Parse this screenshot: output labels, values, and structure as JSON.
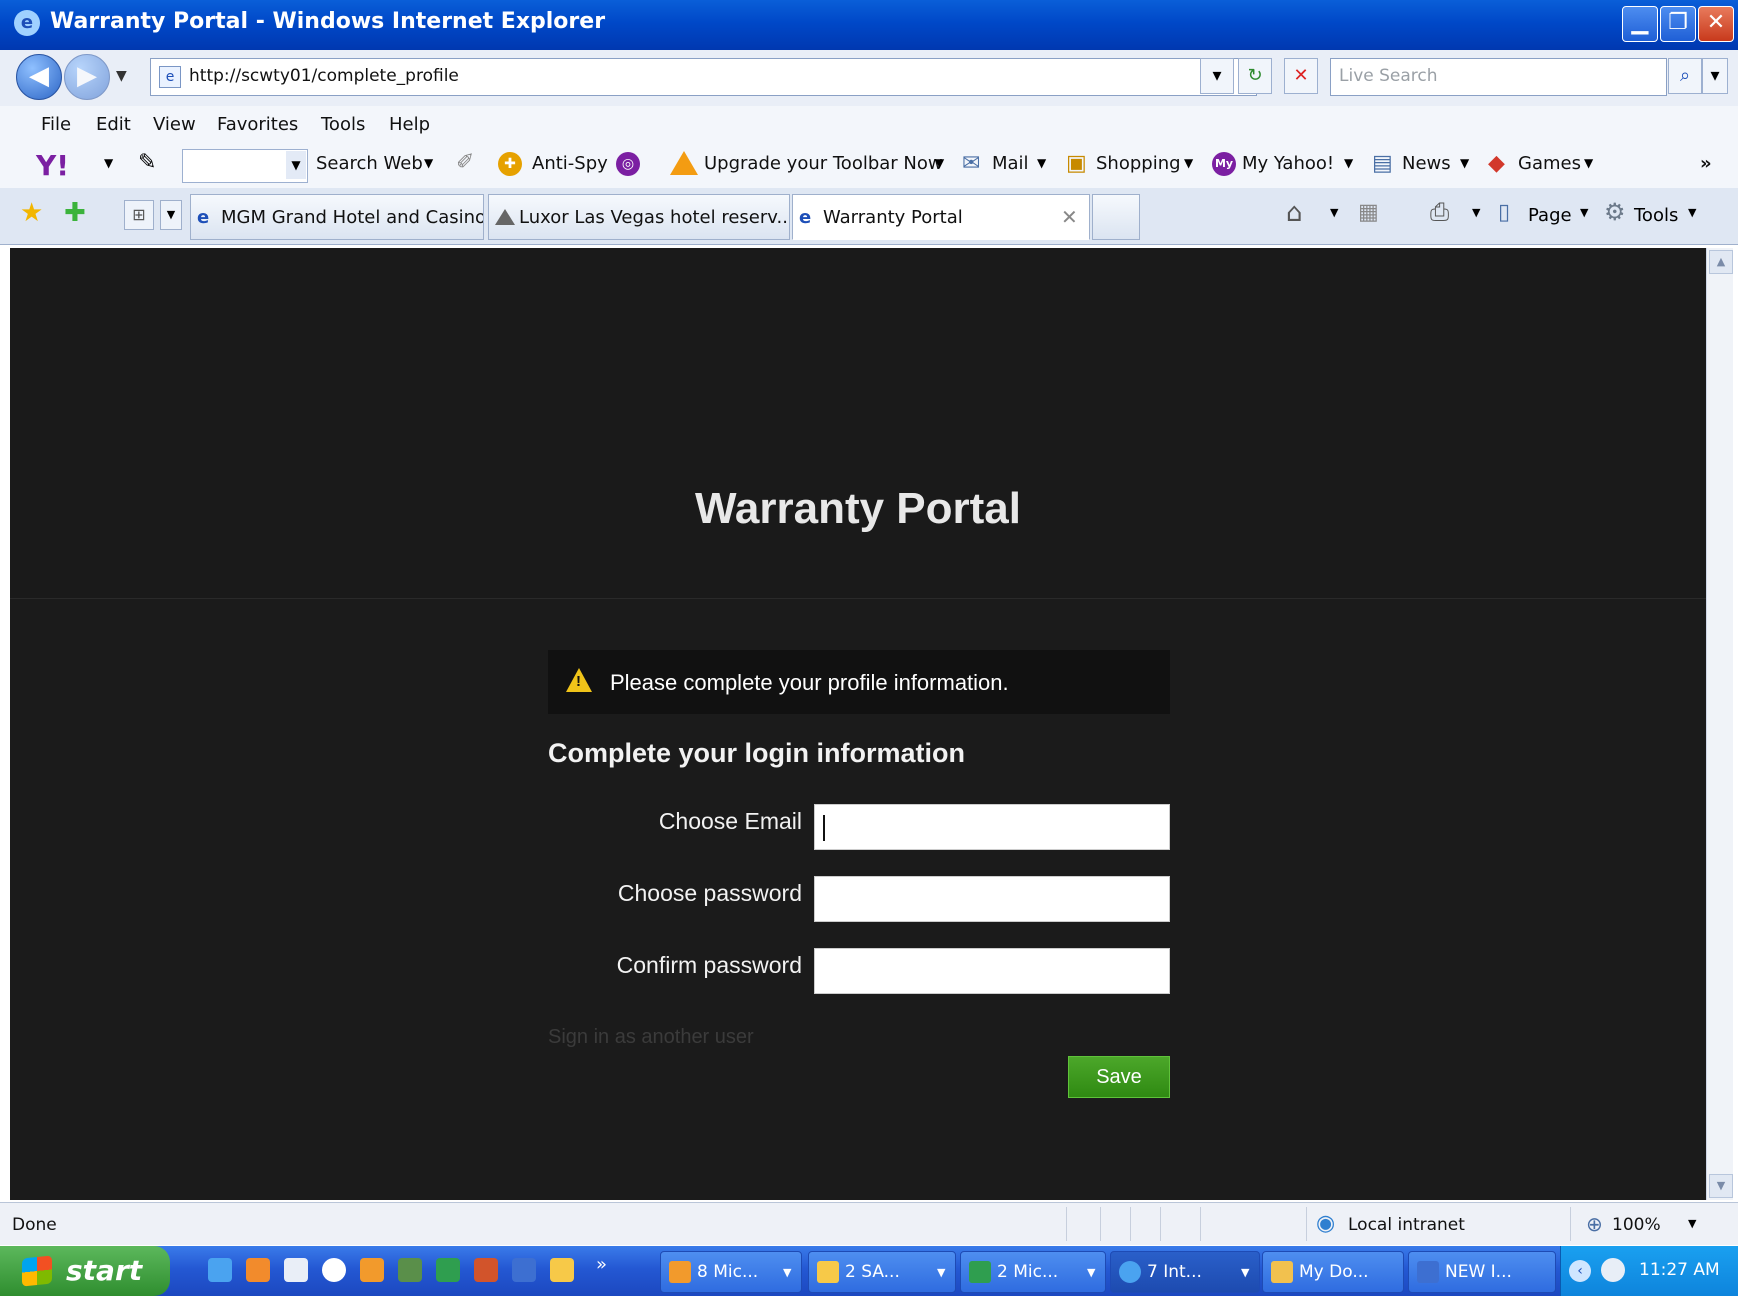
{
  "window": {
    "title": "Warranty Portal - Windows Internet Explorer",
    "minimize": "▁",
    "maximize": "❐",
    "close": "✕"
  },
  "address": {
    "url": "http://scwty01/complete_profile",
    "search_placeholder": "Live Search"
  },
  "menu": {
    "items": [
      "File",
      "Edit",
      "View",
      "Favorites",
      "Tools",
      "Help"
    ]
  },
  "toolbar": {
    "search_web": "Search Web",
    "anti_spy": "Anti-Spy",
    "upgrade": "Upgrade your Toolbar Now",
    "mail": "Mail",
    "shopping": "Shopping",
    "my_yahoo": "My Yahoo!",
    "news": "News",
    "games": "Games",
    "more": "»"
  },
  "tabs": [
    {
      "label": "MGM Grand Hotel and Casino..."
    },
    {
      "label": "Luxor Las Vegas hotel reserv..."
    },
    {
      "label": "Warranty Portal"
    }
  ],
  "command_bar": {
    "page": "Page",
    "tools": "Tools"
  },
  "page": {
    "title": "Warranty Portal",
    "alert": "Please complete your profile information.",
    "form_title": "Complete your login information",
    "fields": {
      "email_label": "Choose Email",
      "password_label": "Choose password",
      "confirm_label": "Confirm password"
    },
    "sign_in_other": "Sign in as another user",
    "save": "Save"
  },
  "status": {
    "text": "Done",
    "zone": "Local intranet",
    "zoom": "100%"
  },
  "taskbar": {
    "start": "start",
    "tasks": [
      {
        "label": "8 Mic...",
        "color": "#f29a2c"
      },
      {
        "label": "2 SA...",
        "color": "#f7c948"
      },
      {
        "label": "2 Mic...",
        "color": "#2f9e4f"
      },
      {
        "label": "7 Int...",
        "color": "#4aa3f0"
      },
      {
        "label": "My Do...",
        "color": "#f2c14e"
      },
      {
        "label": "NEW I...",
        "color": "#3d6fd1"
      }
    ],
    "clock": "11:27 AM"
  },
  "colors": {
    "page_bg": "#1b1b1b",
    "save_green": "#3c9a1e",
    "warning_yellow": "#f0c419"
  }
}
